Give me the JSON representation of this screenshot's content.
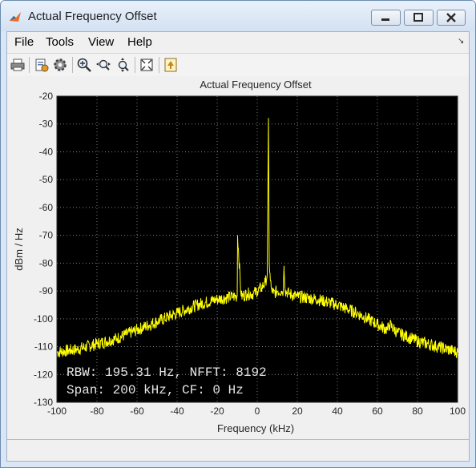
{
  "window": {
    "title": "Actual Frequency Offset"
  },
  "menu": {
    "file": "File",
    "tools": "Tools",
    "view": "View",
    "help": "Help"
  },
  "toolbar": {
    "icons": [
      "print-icon",
      "settings-icon",
      "gear-icon",
      "zoom-in-icon",
      "zoom-x-icon",
      "zoom-y-icon",
      "autoscale-icon",
      "highlight-icon"
    ]
  },
  "colors": {
    "plot_background": "#000000",
    "trace": "#ffff00",
    "grid": "#808080",
    "text_overlay": "#e6e6e6"
  },
  "chart_data": {
    "type": "line",
    "title": "Actual Frequency Offset",
    "xlabel": "Frequency (kHz)",
    "ylabel": "dBm / Hz",
    "xlim": [
      -100,
      100
    ],
    "ylim": [
      -130,
      -20
    ],
    "xticks": [
      "-100",
      "-80",
      "-60",
      "-40",
      "-20",
      "0",
      "20",
      "40",
      "60",
      "80",
      "100"
    ],
    "yticks": [
      "-20",
      "-30",
      "-40",
      "-50",
      "-60",
      "-70",
      "-80",
      "-90",
      "-100",
      "-110",
      "-120",
      "-130"
    ],
    "grid": true,
    "series": [
      {
        "x": [
          -100,
          -90,
          -80,
          -70,
          -60,
          -50,
          -40,
          -30,
          -20,
          -12,
          -10,
          -9.8,
          -8,
          -5,
          -2,
          0,
          2,
          4,
          5,
          5.6,
          6,
          6.5,
          7,
          8,
          10,
          12,
          13,
          13.4,
          14,
          16,
          20,
          30,
          40,
          50,
          60,
          65,
          66,
          70,
          80,
          90,
          100
        ],
        "y": [
          -112,
          -111,
          -109,
          -107,
          -104,
          -101,
          -98,
          -95,
          -93,
          -92,
          -92,
          -70,
          -92,
          -91,
          -91,
          -90,
          -89,
          -87,
          -84,
          -29,
          -80,
          -86,
          -89,
          -91,
          -90,
          -90,
          -90,
          -81,
          -90,
          -91,
          -92,
          -93,
          -95,
          -98,
          -102,
          -104,
          -102,
          -105,
          -108,
          -110,
          -112
        ]
      }
    ],
    "annotations": [
      "RBW: 195.31 Hz, NFFT: 8192",
      "Span: 200 kHz, CF: 0 Hz"
    ]
  }
}
